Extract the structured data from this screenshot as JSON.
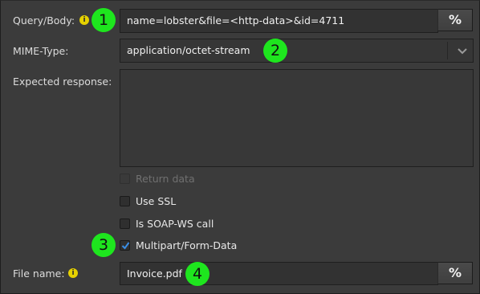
{
  "query_body": {
    "label": "Query/Body:",
    "info_icon": "info-icon",
    "value": "name=lobster&file=<http-data>&id=4711",
    "button_label": "%"
  },
  "mime_type": {
    "label": "MIME-Type:",
    "selected": "application/octet-stream",
    "dropdown_icon": "chevron-down-icon"
  },
  "expected_response": {
    "label": "Expected response:",
    "value": ""
  },
  "options": [
    {
      "label": "Return data",
      "checked": false,
      "enabled": false
    },
    {
      "label": "Use SSL",
      "checked": false,
      "enabled": true
    },
    {
      "label": "Is SOAP-WS call",
      "checked": false,
      "enabled": true
    },
    {
      "label": "Multipart/Form-Data",
      "checked": true,
      "enabled": true
    }
  ],
  "file_name": {
    "label": "File name:",
    "info_icon": "info-icon",
    "value": "Invoice.pdf",
    "button_label": "%"
  },
  "callouts": [
    "1",
    "2",
    "3",
    "4"
  ],
  "colors": {
    "background": "#3b3b3b",
    "field": "#323232",
    "callout": "#1ee61e",
    "info_icon": "#e6d100",
    "checkmark": "#3a8ee6"
  }
}
